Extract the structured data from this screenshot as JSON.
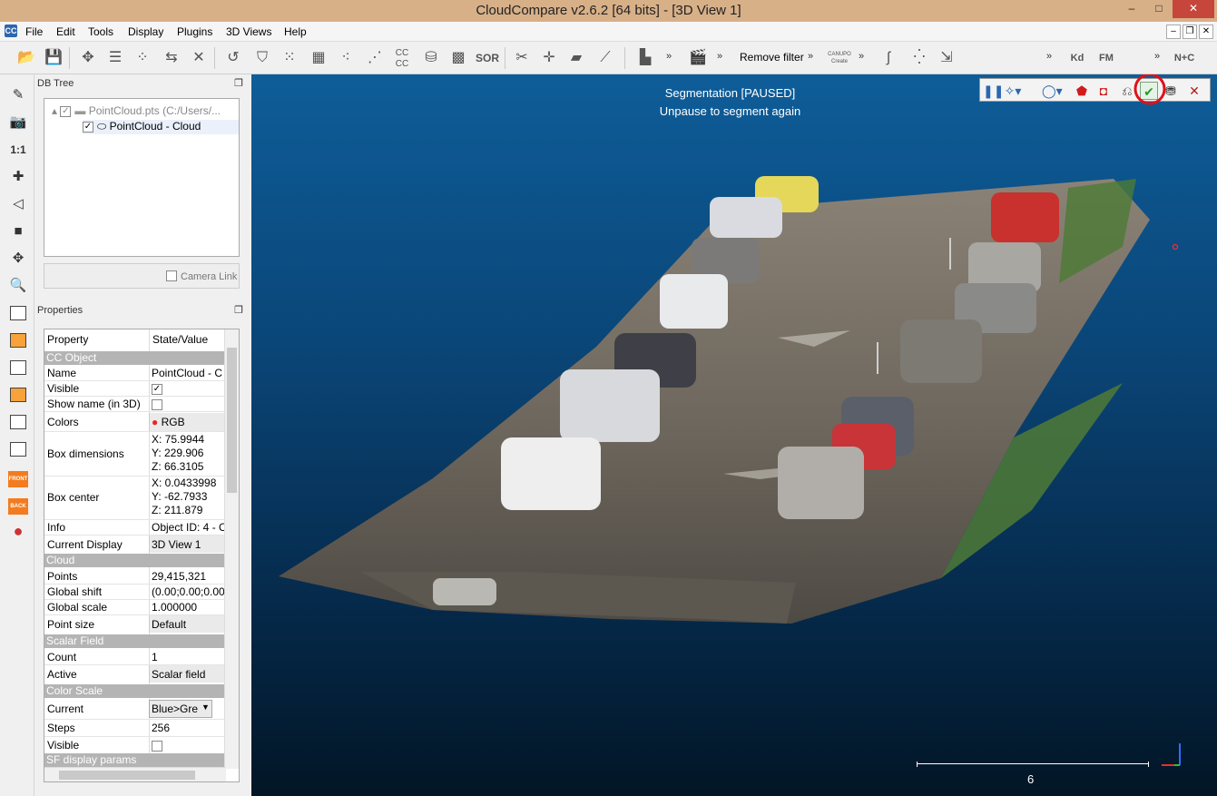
{
  "window": {
    "title": "CloudCompare v2.6.2 [64 bits] - [3D View 1]",
    "minimize": "–",
    "maximize": "□",
    "close": "✕"
  },
  "menu": {
    "app_icon": "CC",
    "items": [
      "File",
      "Edit",
      "Tools",
      "Display",
      "Plugins",
      "3D Views",
      "Help"
    ]
  },
  "mdi": {
    "minimize": "–",
    "restore": "❐",
    "close": "✕"
  },
  "toolbar": {
    "remove_filter": "Remove filter",
    "more": "»",
    "cc_label": "CC CC",
    "sor_label": "SOR",
    "kd_label": "Kd",
    "fm_label": "FM",
    "nc_label": "N+C",
    "canupo_label": "CANUPO Create"
  },
  "left_toolbar": {
    "one_to_one": "1:1",
    "front": "FRONT",
    "back": "BACK"
  },
  "db_tree": {
    "header": "DB Tree",
    "items": [
      {
        "label": "PointCloud.pts (C:/Users/...",
        "checked": true
      },
      {
        "label": "PointCloud - Cloud",
        "checked": true
      }
    ],
    "camera_link": "Camera Link"
  },
  "properties": {
    "header": "Properties",
    "col_property": "Property",
    "col_value": "State/Value",
    "sections": {
      "cc_object": "CC Object",
      "cloud": "Cloud",
      "scalar_field": "Scalar Field",
      "color_scale": "Color Scale",
      "sf_display": "SF display params"
    },
    "rows": {
      "name": {
        "k": "Name",
        "v": "PointCloud - C"
      },
      "visible": {
        "k": "Visible",
        "v": "✓"
      },
      "show_name": {
        "k": "Show name (in 3D)",
        "v": ""
      },
      "colors": {
        "k": "Colors",
        "v": "RGB"
      },
      "box_dim": {
        "k": "Box dimensions",
        "x": "X: 75.9944",
        "y": "Y: 229.906",
        "z": "Z: 66.3105"
      },
      "box_center": {
        "k": "Box center",
        "x": "X: 0.0433998",
        "y": "Y: -62.7933",
        "z": "Z: 211.879"
      },
      "info": {
        "k": "Info",
        "v": "Object ID: 4 - C"
      },
      "current_display": {
        "k": "Current Display",
        "v": "3D View 1"
      },
      "points": {
        "k": "Points",
        "v": "29,415,321"
      },
      "global_shift": {
        "k": "Global shift",
        "v": "(0.00;0.00;0.00)"
      },
      "global_scale": {
        "k": "Global scale",
        "v": "1.000000"
      },
      "point_size": {
        "k": "Point size",
        "v": "Default"
      },
      "count": {
        "k": "Count",
        "v": "1"
      },
      "active": {
        "k": "Active",
        "v": "Scalar field"
      },
      "current": {
        "k": "Current",
        "v": "Blue>Gre"
      },
      "steps": {
        "k": "Steps",
        "v": "256"
      },
      "cs_visible": {
        "k": "Visible",
        "v": ""
      }
    }
  },
  "view3d": {
    "status_line1": "Segmentation [PAUSED]",
    "status_line2": "Unpause to segment again",
    "scale_label": "6"
  },
  "colors": {
    "accent": "#2b66b0",
    "highlight_circle": "#e0101a",
    "confirm_green": "#2a9a2a"
  }
}
